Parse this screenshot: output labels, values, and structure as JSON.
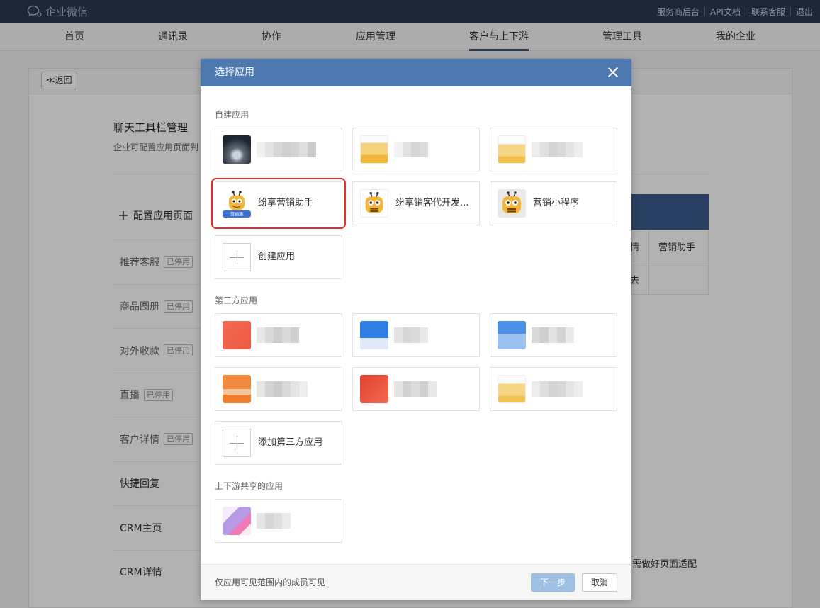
{
  "topbar": {
    "logo_text": "企业微信",
    "links": [
      "服务商后台",
      "API文档",
      "联系客服",
      "退出"
    ]
  },
  "nav": {
    "items": [
      "首页",
      "通讯录",
      "协作",
      "应用管理",
      "客户与上下游",
      "管理工具",
      "我的企业"
    ],
    "active": "客户与上下游"
  },
  "page": {
    "back_label": "≪返回",
    "title": "聊天工具栏管理",
    "subtitle": "企业可配置应用页面到",
    "config_label": "配置应用页面",
    "list": [
      {
        "label": "推荐客服",
        "badge": "已停用"
      },
      {
        "label": "商品图册",
        "badge": "已停用"
      },
      {
        "label": "对外收款",
        "badge": "已停用"
      },
      {
        "label": "直播",
        "badge": "已停用"
      },
      {
        "label": "客户详情",
        "badge": "已停用"
      },
      {
        "label": "快捷回复",
        "badge": ""
      },
      {
        "label": "CRM主页",
        "badge": ""
      },
      {
        "label": "CRM详情",
        "badge": ""
      }
    ],
    "right_col_header": "营销助手",
    "right_col_left_fragment": "情",
    "right_col_row2_fragment": "去",
    "right_bottom_text": "需做好页面适配"
  },
  "modal": {
    "title": "选择应用",
    "sections": {
      "custom": "自建应用",
      "third_party": "第三方应用",
      "shared": "上下游共享的应用"
    },
    "custom_apps": [
      {
        "name": "",
        "blurred": true
      },
      {
        "name": "",
        "blurred": true
      },
      {
        "name": "",
        "blurred": true
      },
      {
        "name": "纷享营销助手",
        "selected": true,
        "icon_caption": "营销通"
      },
      {
        "name": "纷享销客代开发..."
      },
      {
        "name": "营销小程序"
      }
    ],
    "create_app_label": "创建应用",
    "third_party_apps": [
      {
        "name": "",
        "blurred": true
      },
      {
        "name": "",
        "blurred": true
      },
      {
        "name": "",
        "blurred": true
      },
      {
        "name": "",
        "blurred": true
      },
      {
        "name": "",
        "blurred": true
      },
      {
        "name": "",
        "blurred": true
      }
    ],
    "add_third_party_label": "添加第三方应用",
    "shared_apps": [
      {
        "name": "",
        "blurred": true
      }
    ],
    "footer_note": "仅应用可见范围内的成员可见",
    "next_label": "下一步",
    "cancel_label": "取消"
  },
  "colors": {
    "topbar": "#2a3950",
    "modal_header": "#4e78b0",
    "selected_outline": "#e0302a",
    "next_button": "#9ec1e4"
  }
}
